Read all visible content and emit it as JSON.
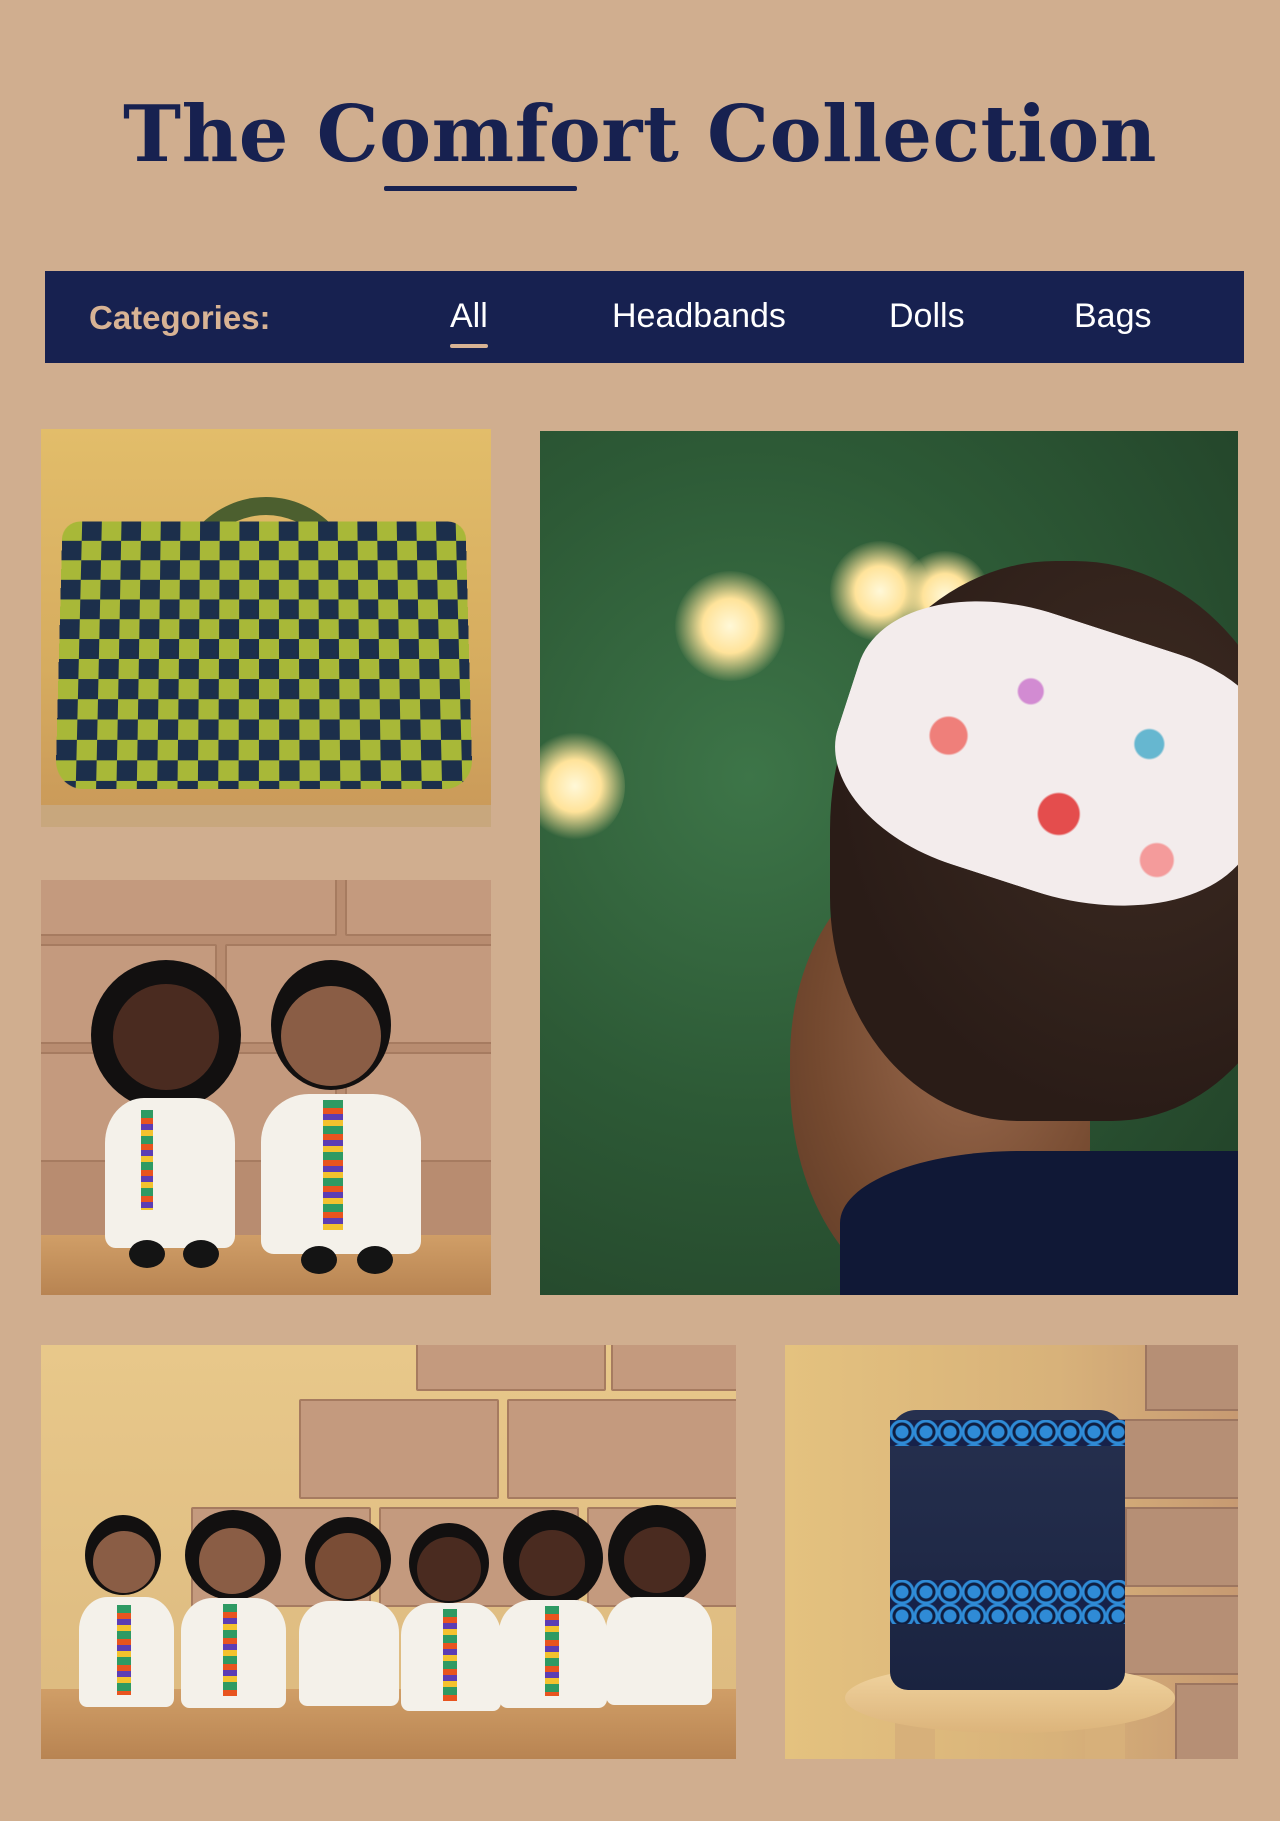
{
  "header": {
    "title": "The Comfort Collection"
  },
  "categories": {
    "label": "Categories:",
    "items": [
      {
        "label": "All",
        "active": true
      },
      {
        "label": "Headbands",
        "active": false
      },
      {
        "label": "Dolls",
        "active": false
      },
      {
        "label": "Bags",
        "active": false
      }
    ]
  },
  "gallery": {
    "tiles": [
      {
        "id": "checkered-tote-bag"
      },
      {
        "id": "floral-headband"
      },
      {
        "id": "doll-pair"
      },
      {
        "id": "doll-group"
      },
      {
        "id": "denim-backpack"
      }
    ]
  },
  "colors": {
    "background": "#d0ae8f",
    "navy": "#172150",
    "accent": "#d8b394"
  }
}
